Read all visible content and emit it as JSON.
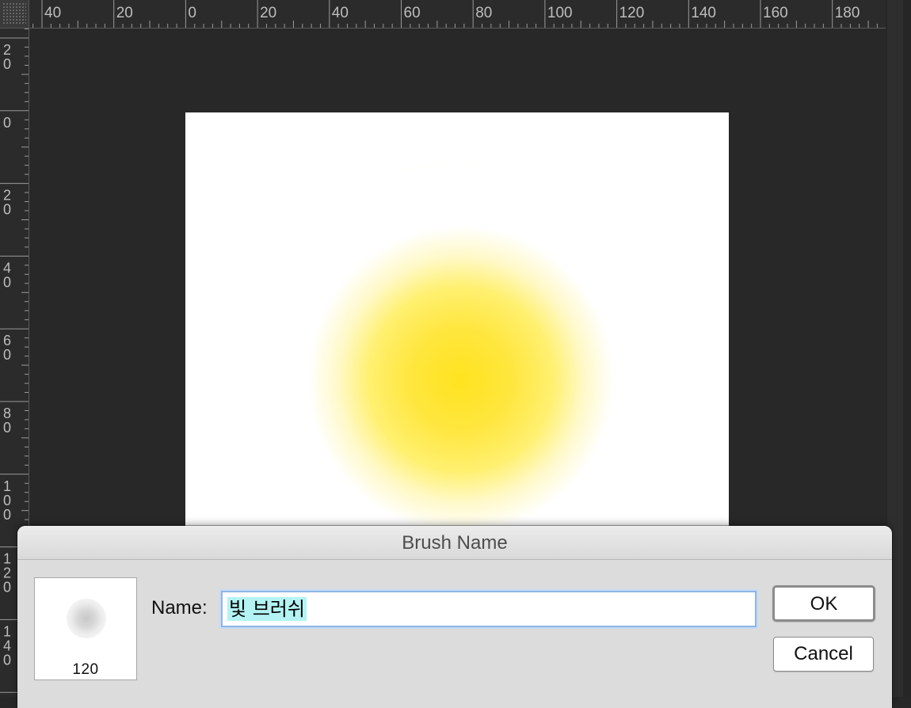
{
  "rulers": {
    "top_labels": [
      "40",
      "20",
      "0",
      "20",
      "40",
      "60",
      "80",
      "100",
      "120",
      "140",
      "160",
      "180"
    ],
    "left_labels": [
      [
        "2",
        "0"
      ],
      [
        "0"
      ],
      [
        "2",
        "0"
      ],
      [
        "4",
        "0"
      ],
      [
        "6",
        "0"
      ],
      [
        "8",
        "0"
      ],
      [
        "1",
        "0",
        "0"
      ],
      [
        "1",
        "2",
        "0"
      ],
      [
        "1",
        "4",
        "0"
      ]
    ]
  },
  "canvas": {
    "glow_center_color": "#ffe320",
    "glow_ring_color": "#fff25a",
    "background": "#ffffff"
  },
  "dialog": {
    "title": "Brush Name",
    "preview_size": "120",
    "name_label": "Name:",
    "name_value": "빛 브러쉬",
    "ok_label": "OK",
    "cancel_label": "Cancel"
  },
  "colors": {
    "workspace": "#282828",
    "dialog_bg": "#dcdcdc",
    "input_focus": "#8fb5e6",
    "selection": "#b4f3f3"
  },
  "icons": {
    "preview": "brush-tip-soft-round"
  }
}
